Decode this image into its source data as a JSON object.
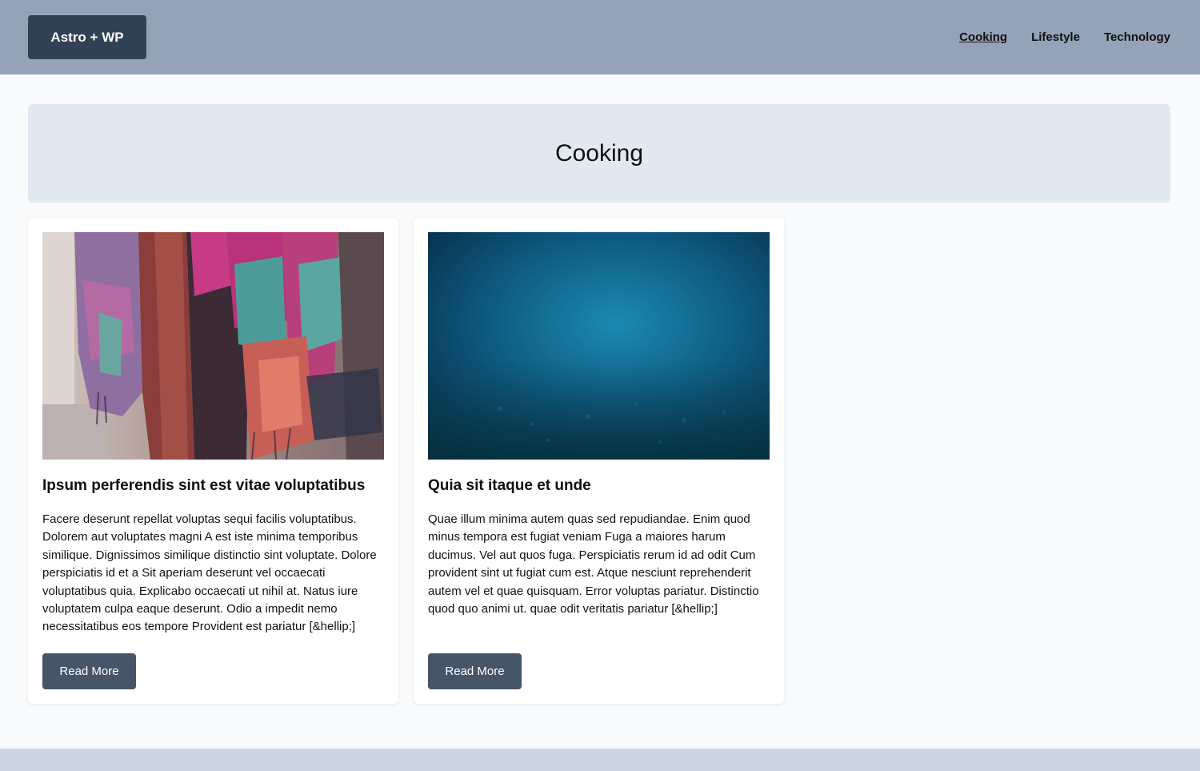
{
  "header": {
    "logo": "Astro + WP",
    "nav": [
      {
        "label": "Cooking",
        "active": true
      },
      {
        "label": "Lifestyle",
        "active": false
      },
      {
        "label": "Technology",
        "active": false
      }
    ]
  },
  "hero": {
    "title": "Cooking"
  },
  "posts": [
    {
      "image": "colorful-woven-blanket-photo",
      "title": "Ipsum perferendis sint est vitae voluptatibus",
      "excerpt": "Facere deserunt repellat voluptas sequi facilis voluptatibus. Dolorem aut voluptates magni A est iste minima temporibus similique. Dignissimos similique distinctio sint voluptate. Dolore perspiciatis id et a Sit aperiam deserunt vel occaecati voluptatibus quia. Explicabo occaecati ut nihil at. Natus iure voluptatem culpa eaque deserunt. Odio a impedit nemo necessitatibus eos tempore Provident est pariatur [&hellip;]",
      "button": "Read More"
    },
    {
      "image": "underwater-ocean-photo",
      "title": "Quia sit itaque et unde",
      "excerpt": "Quae illum minima autem quas sed repudiandae. Enim quod minus tempora est fugiat veniam Fuga a maiores harum ducimus. Vel aut quos fuga. Perspiciatis rerum id ad odit Cum provident sint ut fugiat cum est. Atque nesciunt reprehenderit autem vel et quae quisquam. Error voluptas pariatur. Distinctio quod quo animi ut. quae odit veritatis pariatur [&hellip;]",
      "button": "Read More"
    }
  ],
  "colors": {
    "header_bg": "#94a3b8",
    "logo_bg": "#334155",
    "hero_bg": "#e2e8f0",
    "button_bg": "#475569",
    "page_bg": "#f8fafc",
    "footer_bg": "#cbd5e1"
  }
}
